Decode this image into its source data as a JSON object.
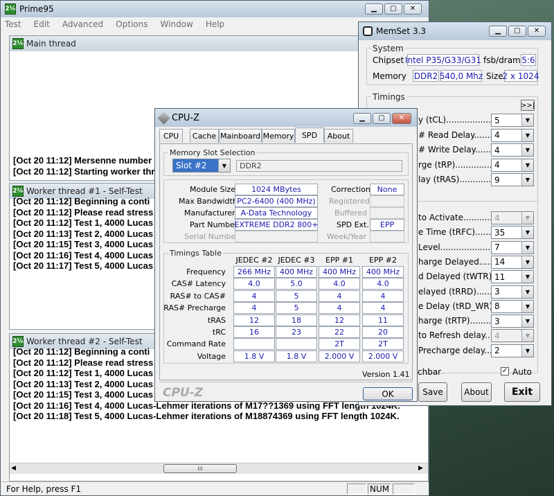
{
  "prime95": {
    "title": "Prime95",
    "icon": "prime95-icon",
    "menu": [
      "Test",
      "Edit",
      "Advanced",
      "Options",
      "Window",
      "Help"
    ],
    "main_thread": {
      "title": "Main thread",
      "lines": [
        "[Oct 20 11:12] Mersenne number",
        "[Oct 20 11:12] Starting worker thr"
      ]
    },
    "worker1": {
      "title": "Worker thread #1 - Self-Test",
      "lines": [
        "[Oct 20 11:12] Beginning a conti",
        "[Oct 20 11:12] Please read stress",
        "[Oct 20 11:12] Test 1, 4000 Lucas",
        "[Oct 20 11:13] Test 2, 4000 Lucas",
        "[Oct 20 11:15] Test 3, 4000 Lucas",
        "[Oct 20 11:16] Test 4, 4000 Lucas",
        "[Oct 20 11:17] Test 5, 4000 Lucas"
      ]
    },
    "worker2": {
      "title": "Worker thread #2 - Self-Test",
      "lines": [
        "[Oct 20 11:12] Beginning a conti",
        "[Oct 20 11:12] Please read stress",
        "[Oct 20 11:12] Test 1, 4000 Lucas",
        "[Oct 20 11:13] Test 2, 4000 Lucas",
        "[Oct 20 11:15] Test 3, 4000 Lucas",
        "[Oct 20 11:16] Test 4, 4000 Lucas-Lehmer iterations of M17??1369 using FFT length 1024K.",
        "[Oct 20 11:18] Test 5, 4000 Lucas-Lehmer iterations of M18874369 using FFT length 1024K."
      ]
    },
    "status": {
      "help": "For Help, press F1",
      "num": "NUM"
    }
  },
  "memset": {
    "title": "MemSet 3.3",
    "system_label": "System",
    "chipset_label": "Chipset",
    "chipset": "Intel P35/G33/G31",
    "fsb_label": "fsb/dram",
    "fsb_value": "5:6",
    "memory_label": "Memory",
    "mem_type": "DDR2",
    "mem_speed": "540,0 Mhz",
    "size_label": "Size",
    "size_value": "2 x 1024",
    "timings_label": "Timings",
    "more_button": ">>|",
    "timings": [
      {
        "label": "y (tCL)...................",
        "value": "5",
        "enabled": true
      },
      {
        "label": "# Read Delay.........",
        "value": "4",
        "enabled": true
      },
      {
        "label": "# Write Delay........",
        "value": "4",
        "enabled": true
      },
      {
        "label": "rge (tRP)...............",
        "value": "4",
        "enabled": true
      },
      {
        "label": "lay  (tRAS)............",
        "value": "9",
        "enabled": true
      }
    ],
    "timings2": [
      {
        "label": "to Activate...............",
        "value": "4",
        "enabled": false
      },
      {
        "label": "e Time (tRFC)..........",
        "value": "35",
        "enabled": true
      },
      {
        "label": "Level.........................",
        "value": "7",
        "enabled": true
      },
      {
        "label": "harge Delayed.........",
        "value": "14",
        "enabled": true
      },
      {
        "label": "d Delayed (tWTR)....",
        "value": "11",
        "enabled": true
      },
      {
        "label": "elayed (tRRD)..........",
        "value": "3",
        "enabled": true
      },
      {
        "label": "e Delay (tRD_WR).....",
        "value": "8",
        "enabled": true
      },
      {
        "label": "harge (tRTP)............",
        "value": "3",
        "enabled": true
      },
      {
        "label": "to Refresh delay........",
        "value": "4",
        "enabled": false
      },
      {
        "label": "Precharge delay.......",
        "value": "2",
        "enabled": true
      }
    ],
    "chbar_label": "chbar",
    "auto_label": "Auto",
    "save_button": "Save",
    "about_button": "About",
    "exit_button": "Exit"
  },
  "cpuz": {
    "title": "CPU-Z",
    "tabs": [
      "CPU",
      "Cache",
      "Mainboard",
      "Memory",
      "SPD",
      "About"
    ],
    "active_tab": "SPD",
    "slot_group": "Memory Slot Selection",
    "slot_selected": "Slot #2",
    "slot_type": "DDR2",
    "module_size_label": "Module Size",
    "module_size": "1024 MBytes",
    "max_bw_label": "Max Bandwidth",
    "max_bw": "PC2-6400 (400 MHz)",
    "manufacturer_label": "Manufacturer",
    "manufacturer": "A-Data Technology",
    "part_label": "Part Number",
    "part": "EXTREME DDR2 800+",
    "serial_label": "Serial Number",
    "serial": "",
    "correction_label": "Correction",
    "correction": "None",
    "registered_label": "Registered",
    "buffered_label": "Buffered",
    "spd_ext_label": "SPD Ext.",
    "spd_ext": "EPP",
    "week_label": "Week/Year",
    "timings_group": "Timings Table",
    "columns": [
      "JEDEC #2",
      "JEDEC #3",
      "EPP #1",
      "EPP #2"
    ],
    "rows": [
      {
        "label": "Frequency",
        "values": [
          "266 MHz",
          "400 MHz",
          "400 MHz",
          "400 MHz"
        ]
      },
      {
        "label": "CAS# Latency",
        "values": [
          "4.0",
          "5.0",
          "4.0",
          "4.0"
        ]
      },
      {
        "label": "RAS# to CAS#",
        "values": [
          "4",
          "5",
          "4",
          "4"
        ]
      },
      {
        "label": "RAS# Precharge",
        "values": [
          "4",
          "5",
          "4",
          "4"
        ]
      },
      {
        "label": "tRAS",
        "values": [
          "12",
          "18",
          "12",
          "11"
        ]
      },
      {
        "label": "tRC",
        "values": [
          "16",
          "23",
          "22",
          "20"
        ]
      },
      {
        "label": "Command Rate",
        "values": [
          "",
          "",
          "2T",
          "2T"
        ]
      },
      {
        "label": "Voltage",
        "values": [
          "1.8 V",
          "1.8 V",
          "2.000 V",
          "2.000 V"
        ]
      }
    ],
    "version": "Version 1.41",
    "brand": "CPU-Z",
    "ok_button": "OK"
  }
}
